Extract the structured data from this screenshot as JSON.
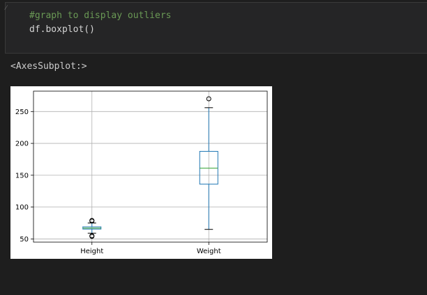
{
  "code_cell": {
    "lines": [
      "#graph to display outliers",
      "df.boxplot()"
    ]
  },
  "output": {
    "text": "<AxesSubplot:>"
  },
  "chart_data": {
    "type": "boxplot",
    "categories": [
      "Height",
      "Weight"
    ],
    "yticks": [
      50,
      100,
      150,
      200,
      250
    ],
    "ylim": [
      45,
      282
    ],
    "grid": true,
    "boxes": [
      {
        "name": "Height",
        "whisker_low": 59,
        "q1": 65.5,
        "median": 67,
        "q3": 69,
        "whisker_high": 75,
        "outliers": [
          54,
          55,
          78,
          79
        ]
      },
      {
        "name": "Weight",
        "whisker_low": 65,
        "q1": 136,
        "median": 161,
        "q3": 187.5,
        "whisker_high": 256,
        "outliers": [
          270
        ]
      }
    ],
    "colors": {
      "box": "#1f77b4",
      "median": "#2ca02c",
      "whisker": "#000000",
      "grid": "#b0b0b0"
    }
  }
}
